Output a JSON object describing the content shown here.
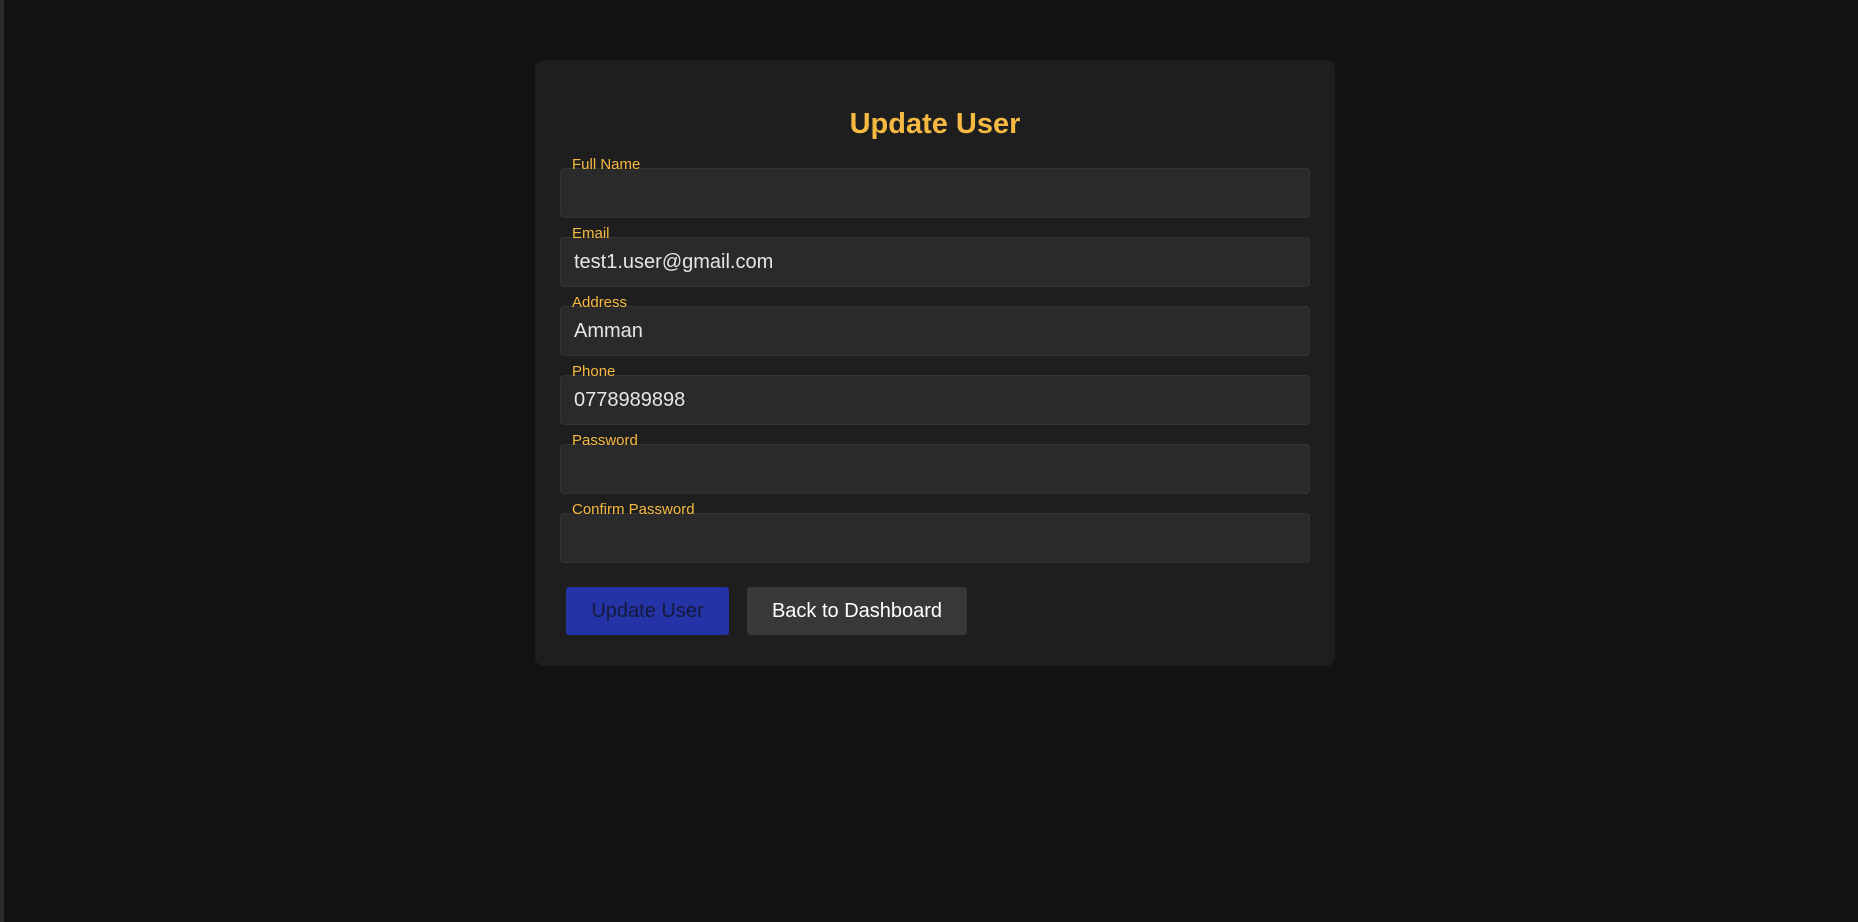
{
  "form": {
    "title": "Update User",
    "fields": [
      {
        "label": "Full Name",
        "value": ""
      },
      {
        "label": "Email",
        "value": "test1.user@gmail.com"
      },
      {
        "label": "Address",
        "value": "Amman"
      },
      {
        "label": "Phone",
        "value": "0778989898"
      },
      {
        "label": "Password",
        "value": ""
      },
      {
        "label": "Confirm Password",
        "value": ""
      }
    ],
    "buttons": {
      "submit_label": "Update User",
      "back_label": "Back to Dashboard"
    }
  },
  "colors": {
    "background": "#121212",
    "card": "#1e1e1e",
    "accent": "#f6b942",
    "primary_button": "#2433a6",
    "secondary_button": "#383838"
  }
}
